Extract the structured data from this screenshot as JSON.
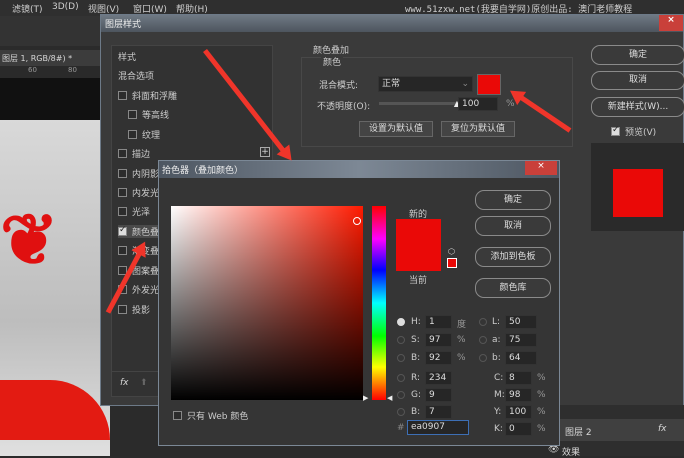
{
  "menu": [
    "滤镜(T)",
    "3D(D)",
    "视图(V)",
    "窗口(W)",
    "帮助(H)"
  ],
  "watermark": "www.51zxw.net(我要自学网)原创出品: 澳门老师教程",
  "doc_tab": "图层 1, RGB/8#) *",
  "ruler": [
    "60",
    "80"
  ],
  "layer_style": {
    "title": "图层样式",
    "styles_header": "样式",
    "blend_options": "混合选项",
    "items": [
      {
        "label": "斜面和浮雕",
        "checked": false
      },
      {
        "label": "等高线",
        "checked": false
      },
      {
        "label": "纹理",
        "checked": false
      },
      {
        "label": "描边",
        "checked": false
      },
      {
        "label": "内阴影",
        "checked": false
      },
      {
        "label": "内发光",
        "checked": false
      },
      {
        "label": "光泽",
        "checked": false
      },
      {
        "label": "颜色叠加",
        "checked": true
      },
      {
        "label": "渐变叠加",
        "checked": false
      },
      {
        "label": "图案叠加",
        "checked": false
      },
      {
        "label": "外发光",
        "checked": false
      },
      {
        "label": "投影",
        "checked": false
      }
    ],
    "fx": "fx",
    "section_title": "颜色叠加",
    "group_title": "颜色",
    "blend_mode_label": "混合模式:",
    "blend_mode": "正常",
    "opacity_label": "不透明度(O):",
    "opacity": "100",
    "percent": "%",
    "overlay_color": "#ea0907",
    "set_default": "设置为默认值",
    "reset_default": "复位为默认值",
    "ok": "确定",
    "cancel": "取消",
    "new_style": "新建样式(W)...",
    "preview": "预览(V)"
  },
  "picker": {
    "title": "拾色器（叠加颜色）",
    "new_label": "新的",
    "current_label": "当前",
    "ok": "确定",
    "cancel": "取消",
    "add_swatch": "添加到色板",
    "color_lib": "颜色库",
    "web_only": "只有 Web 颜色",
    "fields": {
      "H": "1",
      "S": "97",
      "B": "92",
      "R": "234",
      "G": "9",
      "Bb": "7",
      "L": "50",
      "a": "75",
      "b": "64",
      "C": "8",
      "M": "98",
      "Y": "100",
      "K": "0"
    },
    "units": {
      "deg": "度",
      "pct": "%"
    },
    "hex": "ea0907"
  },
  "layers": {
    "layer_name": "图层 2",
    "fx": "fx",
    "effects": "效果"
  }
}
